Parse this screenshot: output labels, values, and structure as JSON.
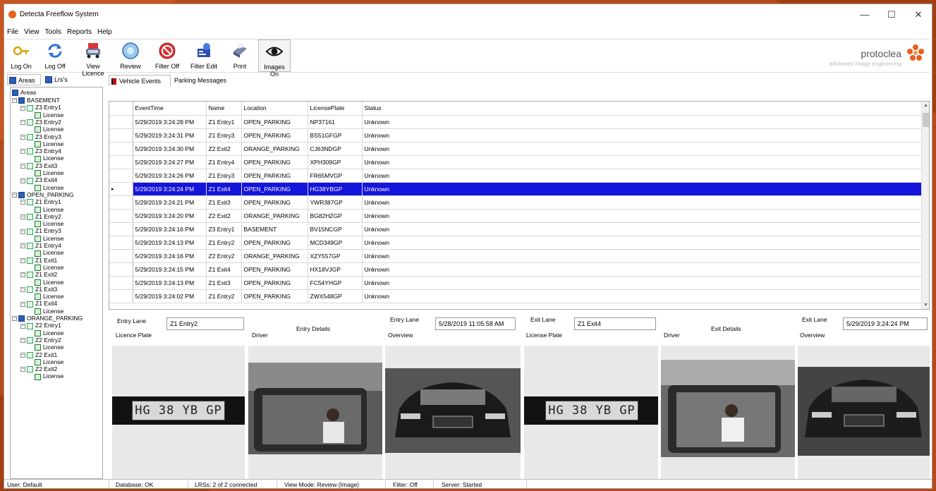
{
  "window": {
    "title": "Detecta Freeflow System",
    "min": "—",
    "max": "☐",
    "close": "✕"
  },
  "menu": [
    "File",
    "View",
    "Tools",
    "Reports",
    "Help"
  ],
  "toolbar": {
    "buttons": [
      {
        "label": "Log On",
        "icon": "key-icon"
      },
      {
        "label": "Log Off",
        "icon": "refresh-arrows-icon"
      },
      {
        "label": "View Licence",
        "icon": "car-icon"
      },
      {
        "label": "Review",
        "icon": "review-disc-icon"
      },
      {
        "label": "Filter Off",
        "icon": "no-entry-icon"
      },
      {
        "label": "Filter Edit",
        "icon": "filter-edit-icon"
      },
      {
        "label": "Print",
        "icon": "printer-icon"
      },
      {
        "label": "Images On",
        "icon": "eye-icon"
      }
    ],
    "logo_text": "protoclea",
    "logo_sub": "advanced image engineering",
    "logo_color": "#e8611d"
  },
  "left_tabs": {
    "areas": "Areas",
    "lrs": "Lrs's"
  },
  "tree": {
    "root": "Areas",
    "areas": [
      {
        "name": "BASEMENT",
        "lanes": [
          "Z3 Entry1",
          "Z3 Entry2",
          "Z3 Entry3",
          "Z3 Entry4",
          "Z3 Exit3",
          "Z3 Exit4"
        ]
      },
      {
        "name": "OPEN_PARKING",
        "lanes": [
          "Z1 Entry1",
          "Z1 Entry2",
          "Z1 Entry3",
          "Z1 Entry4",
          "Z1 Exit1",
          "Z1 Exit2",
          "Z1 Exit3",
          "Z1 Exit4"
        ]
      },
      {
        "name": "ORANGE_PARKING",
        "lanes": [
          "Z2 Entry1",
          "Z2 Entry2",
          "Z2 Exit1",
          "Z2 Exit2"
        ]
      }
    ],
    "leaf_label": "License"
  },
  "right_tabs": {
    "events": "Vehicle Events",
    "messages": "Parking Messages"
  },
  "grid": {
    "columns": [
      "EventTime",
      "Name",
      "Location",
      "LicensePlate",
      "Status"
    ],
    "selected_index": 5,
    "rows": [
      [
        "5/29/2019 3:24:28 PM",
        "Z1 Entry1",
        "OPEN_PARKING",
        "NP37161",
        "Unknown"
      ],
      [
        "5/29/2019 3:24:31 PM",
        "Z1 Entry3",
        "OPEN_PARKING",
        "BS51GFGP",
        "Unknown"
      ],
      [
        "5/29/2019 3:24:30 PM",
        "Z2 Exit2",
        "ORANGE_PARKING",
        "CJ63NDGP",
        "Unknown"
      ],
      [
        "5/29/2019 3:24:27 PM",
        "Z1 Entry4",
        "OPEN_PARKING",
        "XPH309GP",
        "Unknown"
      ],
      [
        "5/29/2019 3:24:26 PM",
        "Z1 Entry3",
        "OPEN_PARKING",
        "FR65MVGP",
        "Unknown"
      ],
      [
        "5/29/2019 3:24:24 PM",
        "Z1 Exit4",
        "OPEN_PARKING",
        "HG38YBGP",
        "Unknown"
      ],
      [
        "5/29/2019 3:24:21 PM",
        "Z1 Exit3",
        "OPEN_PARKING",
        "YWR387GP",
        "Unknown"
      ],
      [
        "5/29/2019 3:24:20 PM",
        "Z2 Exit2",
        "ORANGE_PARKING",
        "BG82HZGP",
        "Unknown"
      ],
      [
        "5/29/2019 3:24:16 PM",
        "Z3 Entry1",
        "BASEMENT",
        "BV15NCGP",
        "Unknown"
      ],
      [
        "5/29/2019 3:24:13 PM",
        "Z1 Entry2",
        "OPEN_PARKING",
        "MCD349GP",
        "Unknown"
      ],
      [
        "5/29/2019 3:24:16 PM",
        "Z2 Entry2",
        "ORANGE_PARKING",
        "XZY557GP",
        "Unknown"
      ],
      [
        "5/29/2019 3:24:15 PM",
        "Z1 Exit4",
        "OPEN_PARKING",
        "HX18VJGP",
        "Unknown"
      ],
      [
        "5/29/2019 3:24:13 PM",
        "Z1 Exit3",
        "OPEN_PARKING",
        "FC54YHGP",
        "Unknown"
      ],
      [
        "5/29/2019 3:24:02 PM",
        "Z1 Entry2",
        "OPEN_PARKING",
        "ZWX548GP",
        "Unknown"
      ]
    ]
  },
  "entry": {
    "lane_label": "Entry Lane",
    "lane_value": "Z1 Entry2",
    "details_title": "Entry Details",
    "time_label": "Entry Lane",
    "time_value": "5/28/2019 11:05:58 AM",
    "plate_label": "Licence Plate",
    "driver_label": "Driver",
    "overview_label": "Overview",
    "plate_text": "HG 38 YB GP"
  },
  "exit": {
    "lane_label": "Exit Lane",
    "lane_value": "Z1 Exit4",
    "details_title": "Exit Details",
    "time_label": "Exit Lane",
    "time_value": "5/29/2019 3:24:24 PM",
    "plate_label": "License Plate",
    "driver_label": "Driver",
    "overview_label": "Overview",
    "plate_text": "HG 38 YB GP"
  },
  "status": {
    "user": "User: Default",
    "database": "Database: OK",
    "lrs": "LRSs: 2 of 2 connected",
    "viewmode": "View Mode: Review (Image)",
    "filter": "Filter: Off",
    "server": "Server: Started"
  },
  "colors": {
    "selection": "#1414dd",
    "background": "#b84a18"
  }
}
